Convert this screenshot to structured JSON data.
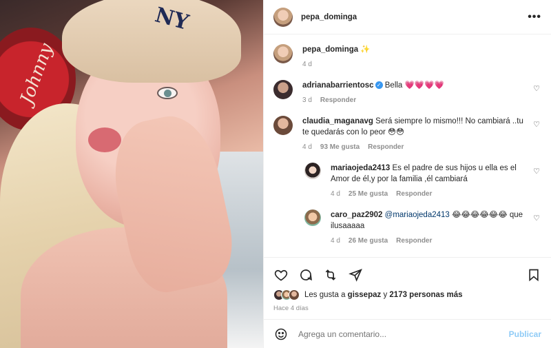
{
  "post": {
    "username": "pepa_dominga",
    "caption_emoji": "✨",
    "caption_time": "4 d"
  },
  "comments": [
    {
      "user": "adrianabarrientosc",
      "verified": true,
      "text": "Bella 💗💗💗💗",
      "time": "3 d",
      "likes": "",
      "reply": "Responder"
    },
    {
      "user": "claudia_maganavg",
      "verified": false,
      "text": "Será siempre lo mismo!!! No cambiará ..tu te quedarás con lo peor 😳😳",
      "time": "4 d",
      "likes": "93 Me gusta",
      "reply": "Responder"
    }
  ],
  "replies": [
    {
      "user": "mariaojeda2413",
      "text": "Es el padre de sus hijos u ella es el Amor de él,y por la familia ,él cambiará",
      "mention": "",
      "time": "4 d",
      "likes": "25 Me gusta",
      "reply": "Responder"
    },
    {
      "user": "caro_paz2902",
      "mention": "@mariaojeda2413",
      "text": "😂😂😂😂😂😂 que ilusaaaaa",
      "time": "4 d",
      "likes": "26 Me gusta",
      "reply": "Responder"
    }
  ],
  "likes": {
    "prefix": "Les gusta a",
    "user": "gissepaz",
    "conj": "y",
    "others": "2173 personas más"
  },
  "posted_ago": "Hace 4 días",
  "composer": {
    "placeholder": "Agrega un comentario...",
    "post_label": "Publicar"
  },
  "icons": {
    "more": "more-icon",
    "heart": "heart-icon",
    "comment": "comment-icon",
    "share": "share-icon",
    "send": "send-icon",
    "save": "save-icon",
    "emoji": "emoji-icon"
  },
  "photo": {
    "sign_text": "Johnny",
    "cap_logo": "NY"
  }
}
